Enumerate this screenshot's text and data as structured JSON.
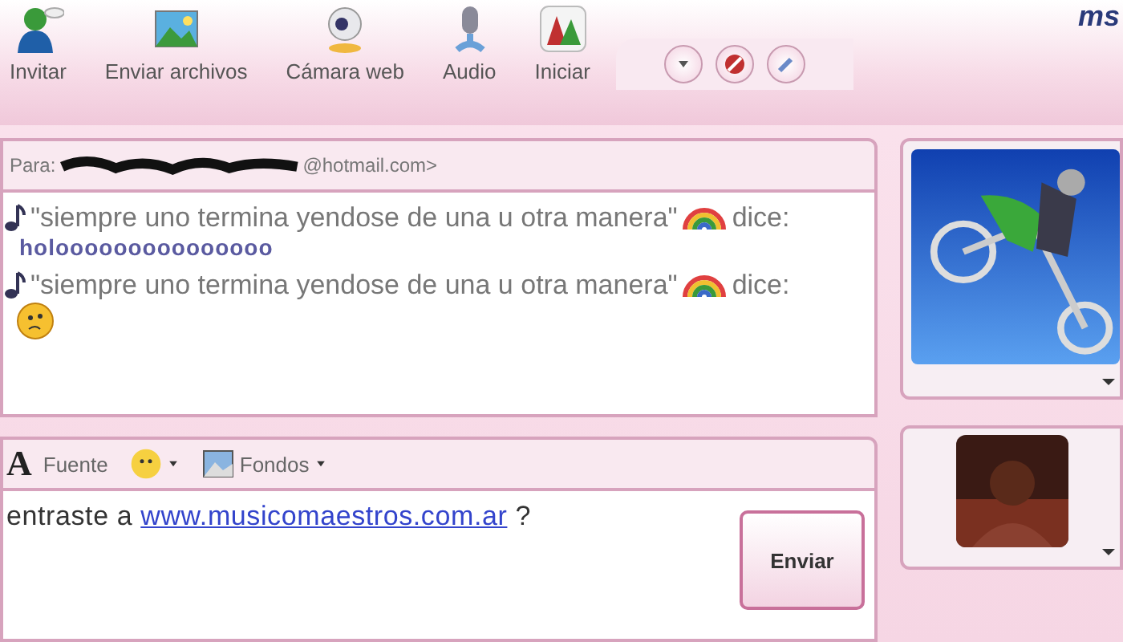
{
  "toolbar": {
    "items": [
      {
        "label": "Invitar"
      },
      {
        "label": "Enviar archivos"
      },
      {
        "label": "Cámara web"
      },
      {
        "label": "Audio"
      },
      {
        "label": "Iniciar"
      }
    ],
    "logo": "ms"
  },
  "to": {
    "label": "Para:",
    "address": "@hotmail.com>"
  },
  "messages": [
    {
      "kind": "text",
      "sender": "\"siempre uno termina yendose de una u otra manera\"",
      "says": "dice:",
      "body": "holooooooooooooooo"
    },
    {
      "kind": "emoticon",
      "sender": "\"siempre uno termina yendose de una u otra manera\"",
      "says": "dice:"
    }
  ],
  "format_bar": {
    "font_letter": "A",
    "font": "Fuente",
    "backgrounds": "Fondos"
  },
  "compose": {
    "before": "entraste a",
    "link": "www.musicomaestros.com.ar",
    "after": "?"
  },
  "send_button": "Enviar"
}
